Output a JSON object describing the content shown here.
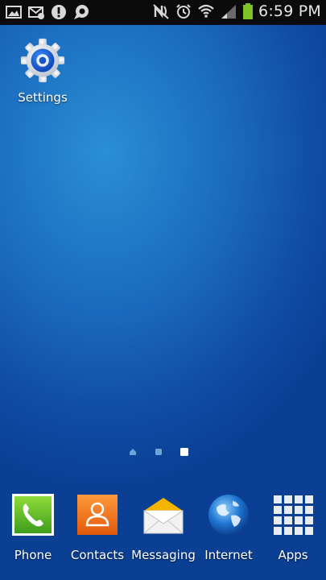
{
  "status_bar": {
    "time": "6:59 PM",
    "notification_icons": [
      "gallery-icon",
      "email-icon",
      "alert-icon",
      "chat-icon"
    ],
    "system_icons": [
      "nfc-off-icon",
      "alarm-icon",
      "wifi-icon",
      "signal-icon",
      "battery-icon"
    ]
  },
  "home": {
    "shortcut": {
      "label": "Settings",
      "icon": "gear-icon"
    }
  },
  "page_indicator": {
    "pages": 3,
    "current": 3
  },
  "dock": {
    "apps": [
      {
        "label": "Phone",
        "icon": "phone-icon"
      },
      {
        "label": "Contacts",
        "icon": "contacts-icon"
      },
      {
        "label": "Messaging",
        "icon": "envelope-icon"
      },
      {
        "label": "Internet",
        "icon": "globe-icon"
      },
      {
        "label": "Apps",
        "icon": "grid-icon"
      }
    ]
  },
  "colors": {
    "wallpaper_center": "#2a8fd4",
    "wallpaper_edge": "#0a3f93",
    "status_bar": "#0b0b0b",
    "battery": "#7ec22a"
  }
}
